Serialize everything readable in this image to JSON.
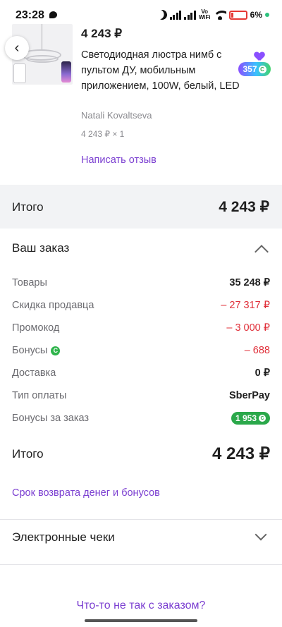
{
  "status_bar": {
    "time": "23:28",
    "vowifi_top": "Vo",
    "vowifi_bottom": "WiFi",
    "battery_pct": "6%"
  },
  "product": {
    "price": "4 243 ₽",
    "title": "Светодиодная люстра нимб с пультом ДУ, мобильным приложением, 100W, белый, LED",
    "seller": "Natali Kovaltseva",
    "qty": "4 243 ₽ × 1",
    "review_link": "Написать отзыв",
    "bonus_badge": "357"
  },
  "total_band": {
    "label": "Итого",
    "value": "4 243 ₽"
  },
  "order": {
    "header": "Ваш заказ",
    "rows": [
      {
        "label": "Товары",
        "value": "35 248 ₽"
      },
      {
        "label": "Скидка продавца",
        "value": "– 27 317 ₽"
      },
      {
        "label": "Промокод",
        "value": "– 3 000 ₽"
      },
      {
        "label": "Бонусы",
        "value": "– 688"
      },
      {
        "label": "Доставка",
        "value": "0 ₽"
      },
      {
        "label": "Тип оплаты",
        "value": "SberPay"
      },
      {
        "label": "Бонусы за заказ",
        "value": "1 953"
      }
    ],
    "final_label": "Итого",
    "final_value": "4 243 ₽",
    "refund_link": "Срок возврата денег и бонусов"
  },
  "receipts": {
    "label": "Электронные чеки"
  },
  "problem_link": "Что-то не так с заказом?",
  "colors": {
    "accent": "#7b3fd1",
    "discount": "#e0303a",
    "bonus_green": "#2aa84a",
    "band_bg": "#f2f3f5"
  }
}
